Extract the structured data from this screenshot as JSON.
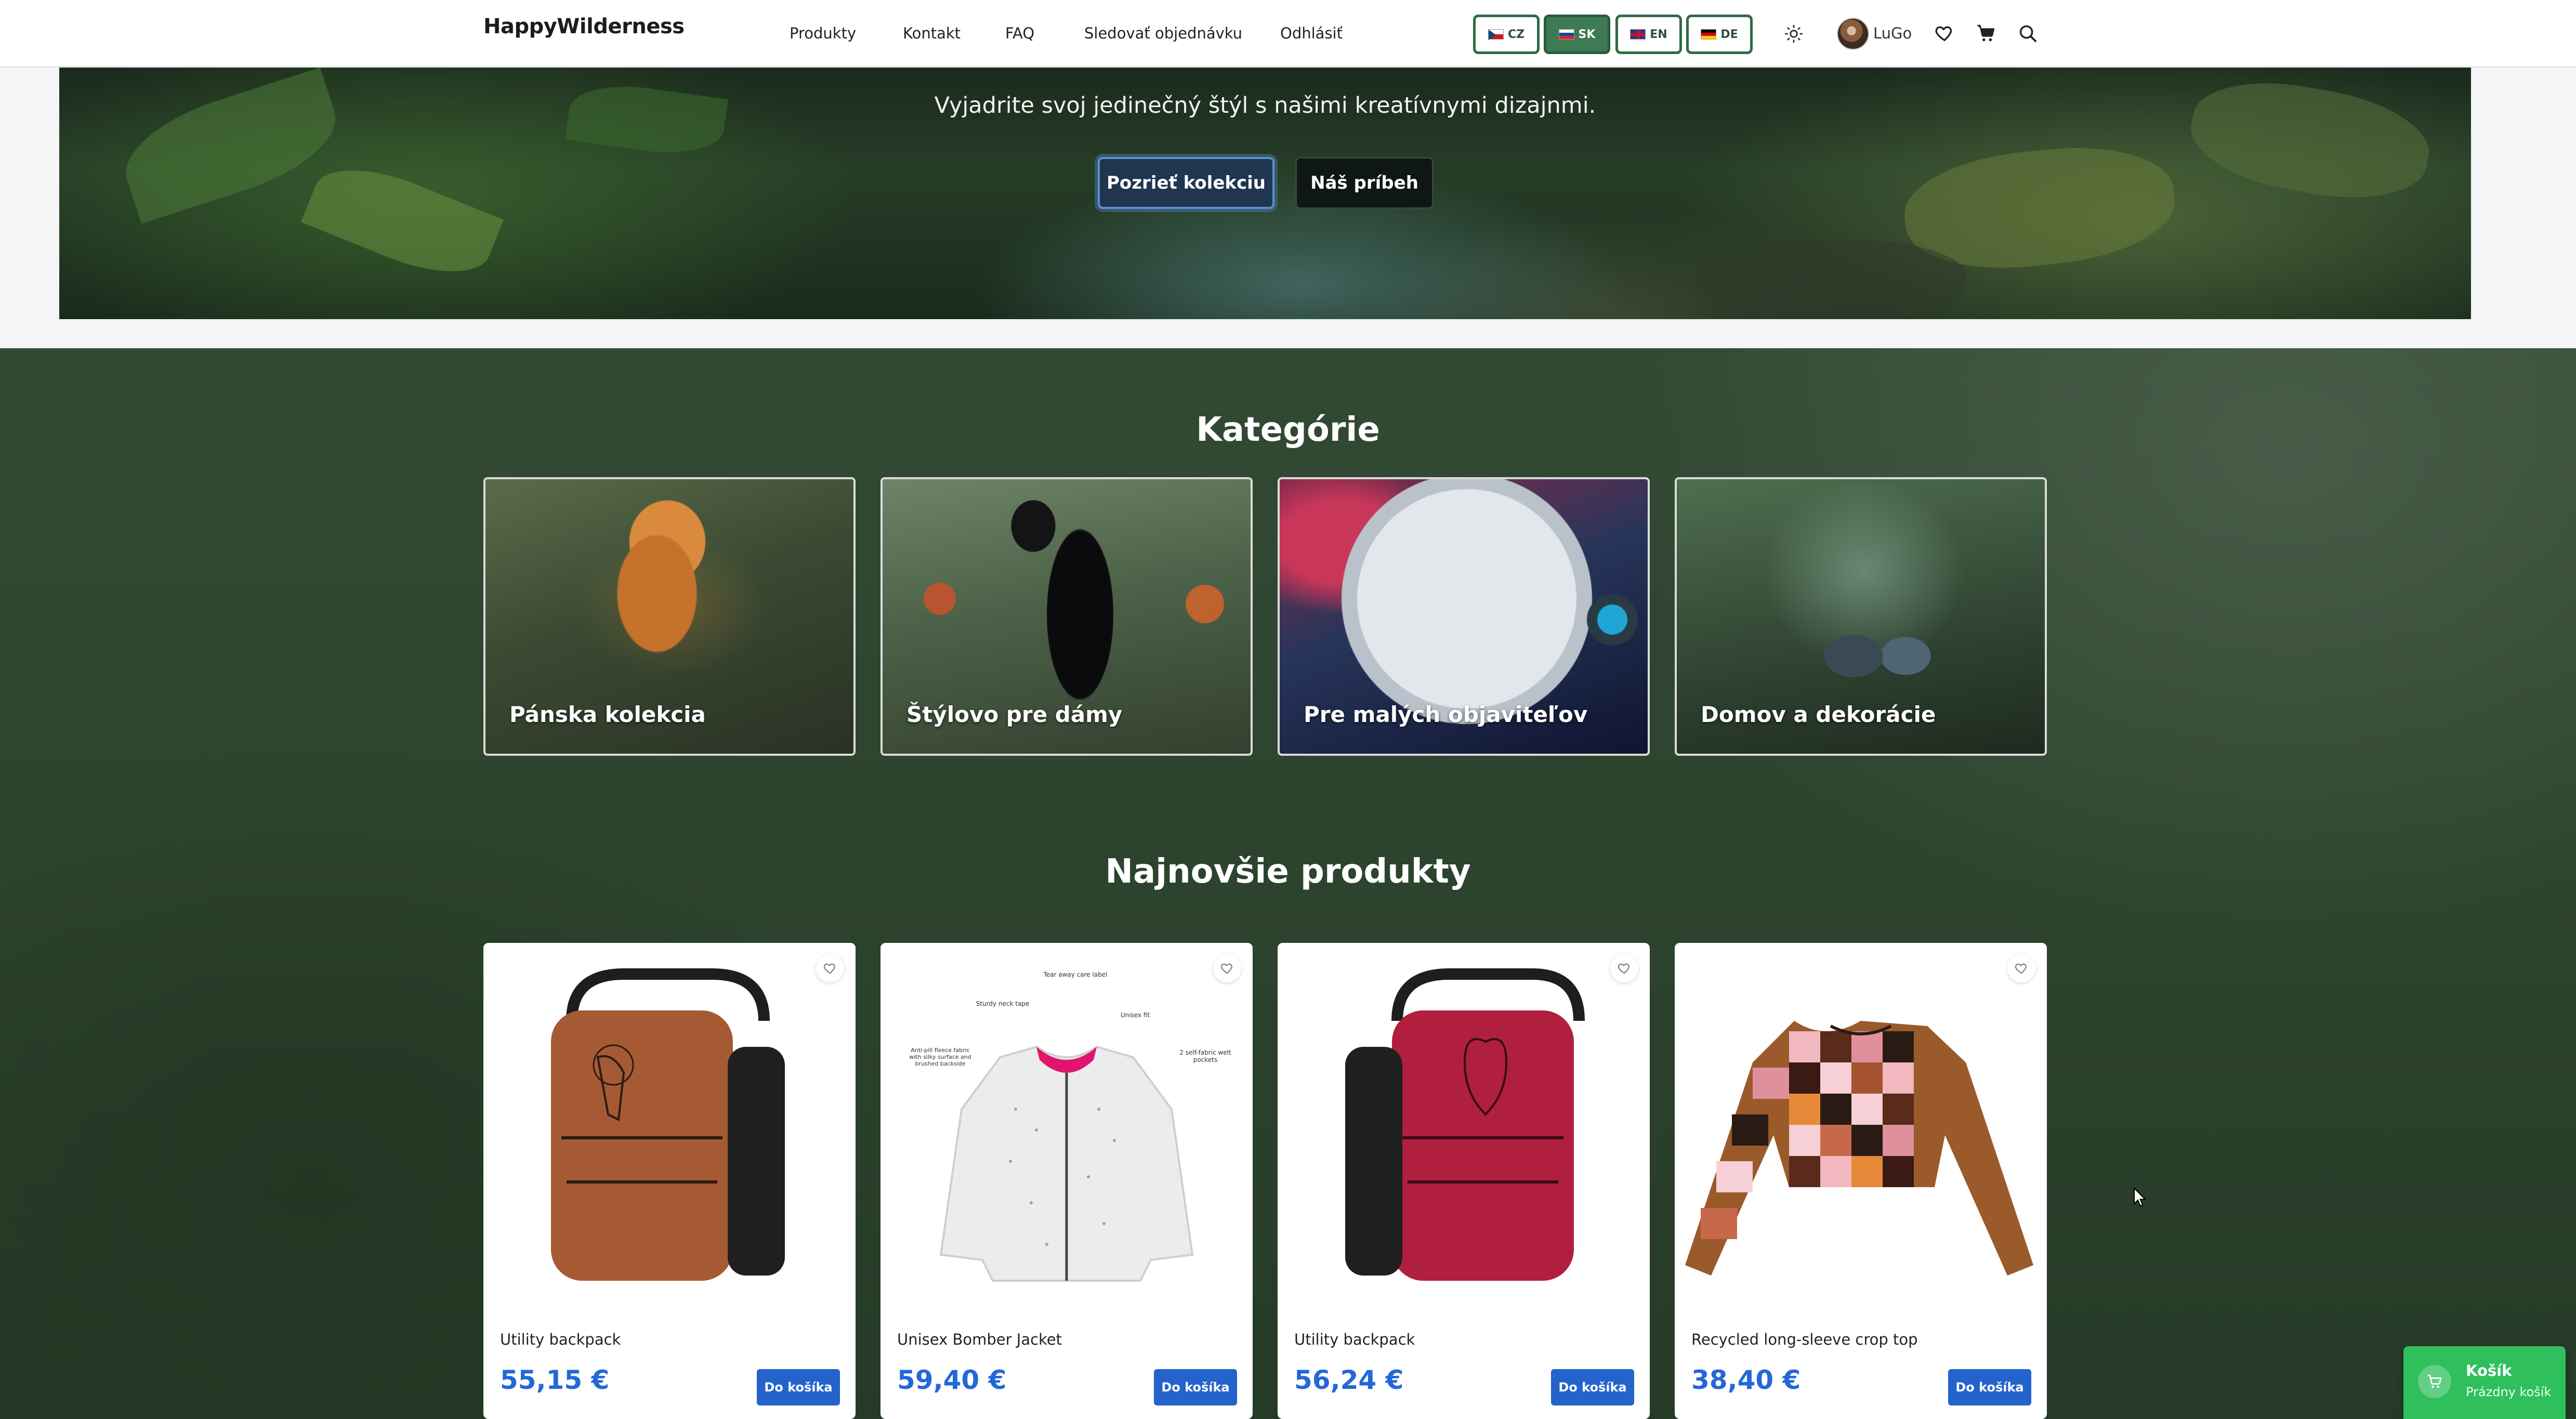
{
  "header": {
    "brand": "HappyWilderness",
    "nav": [
      "Produkty",
      "Kontakt",
      "FAQ",
      "Sledovať objednávku",
      "Odhlásiť"
    ],
    "languages": [
      {
        "code": "CZ",
        "active": false,
        "flag": "flag-cz"
      },
      {
        "code": "SK",
        "active": true,
        "flag": "flag-sk"
      },
      {
        "code": "EN",
        "active": false,
        "flag": "flag-en"
      },
      {
        "code": "DE",
        "active": false,
        "flag": "flag-de"
      }
    ],
    "user_name": "LuGo",
    "icons": [
      "sun-icon",
      "heart-icon",
      "cart-icon",
      "search-icon"
    ]
  },
  "hero": {
    "tagline": "Vyjadrite svoj jedinečný štýl s našimi kreatívnymi dizajnmi.",
    "primary_button": "Pozrieť kolekciu",
    "secondary_button": "Náš príbeh"
  },
  "categories": {
    "title": "Kategórie",
    "items": [
      {
        "label": "Pánska kolekcia"
      },
      {
        "label": "Štýlovo pre dámy"
      },
      {
        "label": "Pre malých objaviteľov"
      },
      {
        "label": "Domov a dekorácie"
      }
    ]
  },
  "products": {
    "title": "Najnovšie produkty",
    "add_label": "Do košíka",
    "items": [
      {
        "name": "Utility backpack",
        "price": "55,15 €",
        "color": "#a55a34"
      },
      {
        "name": "Unisex Bomber Jacket",
        "price": "59,40 €",
        "color": "#e8e8e8"
      },
      {
        "name": "Utility backpack",
        "price": "56,24 €",
        "color": "#b01f3e"
      },
      {
        "name": "Recycled long-sleeve crop top",
        "price": "38,40 €",
        "color": "#9a5a2a"
      }
    ],
    "jacket_callouts": [
      "Tear away care label",
      "Sturdy neck tape",
      "Unisex fit",
      "Anti-pill fleece fabric with silky surface and brushed backside",
      "2 self-fabric welt pockets"
    ]
  },
  "cart_widget": {
    "title": "Košík",
    "subtitle": "Prázdny košík"
  },
  "colors": {
    "accent_green": "#3e7a54",
    "price_blue": "#2368d8",
    "button_blue": "#2463cc",
    "cart_green": "#2fbf5d"
  }
}
